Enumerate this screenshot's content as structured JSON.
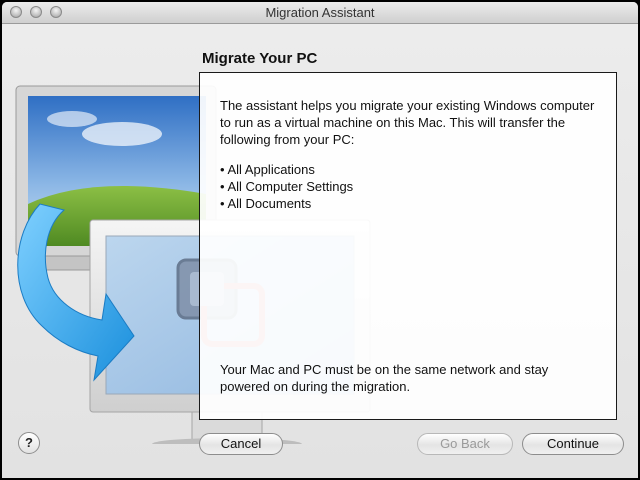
{
  "window": {
    "title": "Migration Assistant",
    "buttons": [
      "close",
      "minimize",
      "zoom"
    ]
  },
  "page": {
    "heading": "Migrate Your PC",
    "intro": "The assistant helps you migrate your existing Windows computer to run as a virtual machine on this Mac. This will transfer the following from your PC:",
    "items": [
      "All Applications",
      "All Computer Settings",
      "All Documents"
    ],
    "note": "Your Mac and PC must be on the same network and stay powered on during the migration."
  },
  "footer": {
    "help_label": "?",
    "cancel_label": "Cancel",
    "back_label": "Go Back",
    "continue_label": "Continue"
  },
  "illustration": {
    "icons": [
      "pc-monitor-icon",
      "migration-arrow-icon",
      "mac-display-icon",
      "vmware-logo-icon"
    ],
    "colors": {
      "arrow": "#2fa3e8",
      "sky": "#3d7fcf",
      "grass": "#6fa63a",
      "logo": "#d96a5a"
    }
  }
}
